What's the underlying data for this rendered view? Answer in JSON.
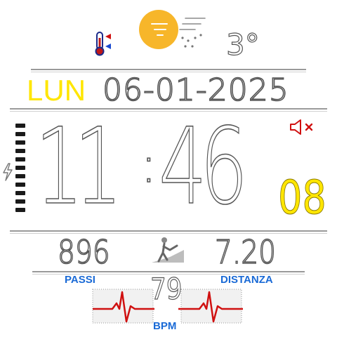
{
  "weather": {
    "temperature": "3°",
    "icon": "sun-with-snow-icon",
    "thermometer_icon": "thermometer-icon"
  },
  "date": {
    "weekday": "LUN",
    "date": "06-01-2025"
  },
  "time": {
    "hours": "11",
    "separator": ":",
    "minutes": "46",
    "seconds": "08"
  },
  "status": {
    "mute_icon": "speaker-muted-icon",
    "charge_icon": "lightning-icon",
    "battery_level": 1.0,
    "battery_segments": 10
  },
  "stats": {
    "steps_value": "896",
    "steps_label": "PASSI",
    "distance_value": "7.20",
    "distance_label": "DISTANZA",
    "walker_icon": "walking-person-icon"
  },
  "heart": {
    "bpm_value": "79",
    "bpm_label": "BPM",
    "ecg_icon": "ecg-wave-icon"
  },
  "colors": {
    "accent_yellow": "#ffe600",
    "label_blue": "#1a6ad6",
    "ecg_red": "#d01010",
    "outline_gray": "#555555"
  }
}
